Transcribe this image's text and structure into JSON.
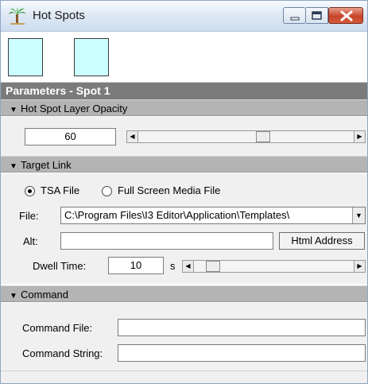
{
  "window": {
    "title": "Hot Spots",
    "icon": "palm-tree-icon"
  },
  "titlebar_buttons": [
    "minimize-icon",
    "maximize-icon",
    "close-icon"
  ],
  "swatches": [
    {
      "color": "#ccffff"
    },
    {
      "color": "#ccffff"
    }
  ],
  "parameters": {
    "header": "Parameters - Spot 1"
  },
  "opacity": {
    "header": "Hot Spot Layer Opacity",
    "value": "60",
    "slider_level": 0.6
  },
  "target_link": {
    "header": "Target Link",
    "radio_tsa": "TSA File",
    "radio_full_screen": "Full Screen Media File",
    "selected": "TSA File",
    "file_label": "File:",
    "file_value": "C:\\Program Files\\I3 Editor\\Application\\Templates\\",
    "alt_label": "Alt:",
    "alt_value": "",
    "html_address_button": "Html Address",
    "dwell_label": "Dwell Time:",
    "dwell_value": "10",
    "dwell_unit": "s",
    "dwell_slider_level": 0.1
  },
  "command": {
    "header": "Command",
    "file_label": "Command File:",
    "file_value": "",
    "string_label": "Command String:",
    "string_value": ""
  }
}
